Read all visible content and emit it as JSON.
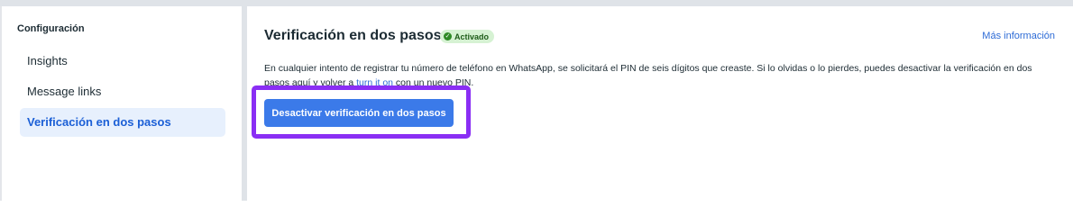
{
  "sidebar": {
    "heading": "Configuración",
    "items": [
      {
        "label": "Insights"
      },
      {
        "label": "Message links"
      },
      {
        "label": "Verificación en dos pasos"
      }
    ],
    "active_color": "#1b5fd6"
  },
  "main": {
    "title": "Verificación en dos pasos",
    "status_badge": {
      "label": "Activado",
      "icon": "check-circle-icon",
      "color": "#2e8a25"
    },
    "more_info_link": "Más información",
    "description": {
      "text_before": "En cualquier intento de registrar tu número de teléfono en WhatsApp, se solicitará el PIN de seis dígitos que creaste. Si lo olvidas o lo pierdes, puedes desactivar la verificación en dos pasos aquí y volver a ",
      "link": "turn it on",
      "text_after": " con un nuevo PIN."
    },
    "primary_button": {
      "label": "Desactivar verificación en dos pasos",
      "color": "#3b7ae9"
    },
    "highlight_color": "#8a2ef4"
  }
}
